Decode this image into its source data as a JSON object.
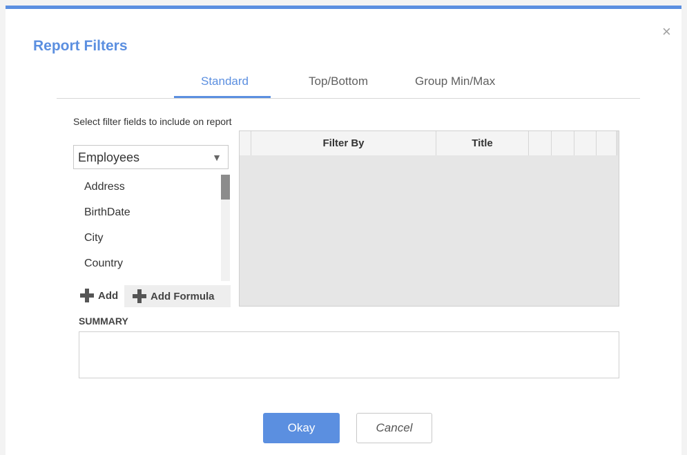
{
  "dialog": {
    "title": "Report Filters",
    "close_icon": "close-icon",
    "close_glyph": "×",
    "accent": "#5b8fe0"
  },
  "tabs": [
    {
      "label": "Standard",
      "active": true
    },
    {
      "label": "Top/Bottom",
      "active": false
    },
    {
      "label": "Group Min/Max",
      "active": false
    }
  ],
  "instructions": "Select filter fields to include on report",
  "table_select": {
    "value": "Employees",
    "arrow_glyph": "▼"
  },
  "fields": [
    "Address",
    "BirthDate",
    "City",
    "Country"
  ],
  "actions": {
    "add_label": "Add",
    "add_formula_label": "Add Formula"
  },
  "grid": {
    "columns": [
      "Filter By",
      "Title"
    ]
  },
  "summary": {
    "label": "SUMMARY",
    "text": ""
  },
  "buttons": {
    "okay": "Okay",
    "cancel": "Cancel"
  }
}
